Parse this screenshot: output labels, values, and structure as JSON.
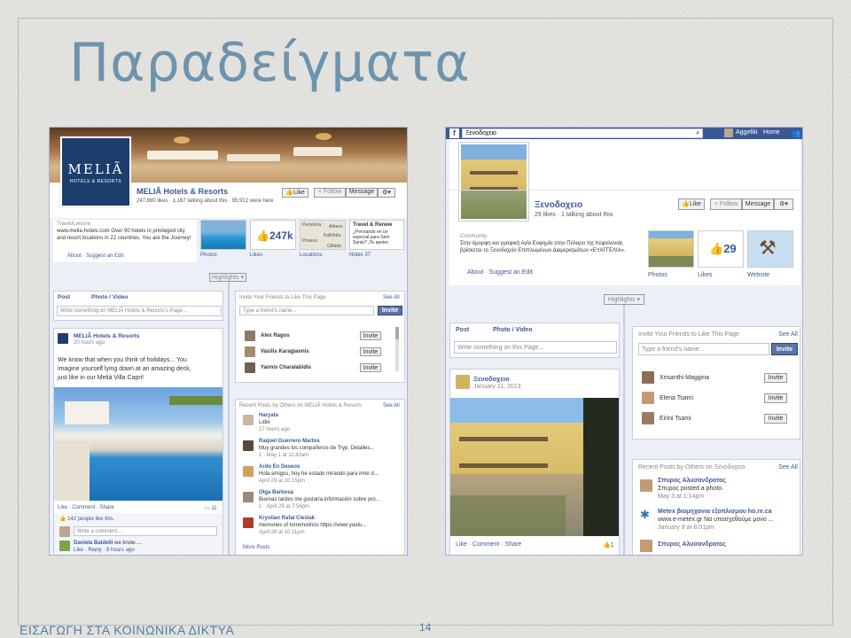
{
  "slide": {
    "title": "Παραδείγματα",
    "footer": "ΕΙΣΑΓΩΓΗ ΣΤΑ ΚΟΙΝΩΝΙΚΑ ΔΙΚΤΥΑ",
    "page_number": "14"
  },
  "left": {
    "logo_text": "MELIÃ",
    "logo_sub": "HOTELS & RESORTS",
    "page_name": "MELIÃ Hotels & Resorts",
    "stats": "247,880 likes · 1,167 talking about this · 95,912 were here",
    "like_btn": "Like",
    "follow_btn": "Follow",
    "message_btn": "Message",
    "category": "Travel/Leisure",
    "about_text": "www.melia-hotels.com Over 90 hotels in privileged city and resort locations in 22 countries. You are the Journey!",
    "about_link": "About",
    "suggest_link": "Suggest an Edit",
    "tabs": [
      "Photos",
      "Likes",
      "Locations",
      "Notes 37"
    ],
    "likes_count": "247k",
    "notes_title": "Travel & Renew",
    "notes_text": "¿Pensando en un especial para Sem Santa? ¡Te apetec",
    "map_labels": [
      "Peristéria",
      "Athens",
      "Kallithéa",
      "Piraeus",
      "Glifáda"
    ],
    "highlights": "Highlights",
    "composer_post": "Post",
    "composer_photo": "Photo / Video",
    "composer_placeholder": "Write something on MELIÃ Hotels & Resorts's Page...",
    "post_author": "MELIÃ Hotels & Resorts",
    "post_time": "20 hours ago",
    "post_text_1": "We know that when you think of holidays... You",
    "post_text_2": "imagine yourself lying down at an amazing deck,",
    "post_text_3": "just like in our Meliá Villa Capri!",
    "post_actions": "Like · Comment · Share",
    "post_shares": "11",
    "post_likes": "142 people like this.",
    "comment_placeholder": "Write a comment...",
    "comment_author": "Daniela Baldelli",
    "comment_text": "we know.....",
    "comment_meta": "Like · Reply · 8 hours ago",
    "invite_title": "Invite Your Friends to Like This Page",
    "see_all": "See All",
    "friend_placeholder": "Type a friend's name...",
    "invite_btn": "Invite",
    "friends": [
      "Alex Ragos",
      "Vasilis Karagiannis",
      "Yannis Charalabidis"
    ],
    "recent_title": "Recent Posts by Others on MELIÃ Hotels & Resorts",
    "recent": [
      {
        "name": "Haryata",
        "text": "Lidie",
        "meta": "17 hours ago"
      },
      {
        "name": "Raquel Guerrero Martos",
        "text": "Muy grandes los compañeros de Tryp. Detalles...",
        "meta": "1 · May 1 at 11:42am"
      },
      {
        "name": "Ardo En Deseos",
        "text": "Hola amigos, hoy he estado mirando para irme d...",
        "meta": "April 29 at 10:15pm"
      },
      {
        "name": "Olga Barbosa",
        "text": "Buenas tardes me gustaría información sobre pro...",
        "meta": "1 · April 29 at 7:56pm"
      },
      {
        "name": "Krystian Rafał Cieślak",
        "text": "memories of torremolinos https://www.youtu...",
        "meta": "April 28 at 10:11pm"
      }
    ],
    "more_posts": "More Posts"
  },
  "right": {
    "search_value": "Ξενοδοχειο",
    "user_name": "Aggeliki",
    "home": "Home",
    "page_name": "Ξενοδοχειο",
    "stats": "29 likes · 1 talking about this",
    "like_btn": "Like",
    "follow_btn": "Follow",
    "message_btn": "Message",
    "category": "Community",
    "about_text": "Στην όμορφη και γραφική Αγία Ευφημία στην Πύλαρο της Κεφαλονιάς βρίσκεται το Ξενοδοχείο Επιπλωμένων Διαμερισμάτων «ΕΥΑΓΓΕΛΙΑ».",
    "about_link": "About",
    "suggest_link": "Suggest an Edit",
    "tabs": [
      "Photos",
      "Likes",
      "Website"
    ],
    "likes_count": "29",
    "highlights": "Highlights",
    "composer_post": "Post",
    "composer_photo": "Photo / Video",
    "composer_placeholder": "Write something on this Page...",
    "post_author": "Ξενοδοχειο",
    "post_time": "January 11, 2013",
    "post_actions": "Like · Comment · Share",
    "post_likes": "1",
    "invite_title": "Invite Your Friends to Like This Page",
    "see_all": "See All",
    "friend_placeholder": "Type a friend's name...",
    "invite_btn": "Invite",
    "friends": [
      "Xrisanthi Maggina",
      "Elena Tsami",
      "Eirini Tsami"
    ],
    "recent_title": "Recent Posts by Others on Ξενοδοχειο",
    "recent": [
      {
        "name": "Σπυρος Αλυσανδρατος",
        "text": "Σπυρος posted a photo.",
        "meta": "May 3 at 1:14pm"
      },
      {
        "name": "Metex βιομηχανια εξοπλισμου ho.re.ca",
        "text": "www.e-metex.gr Να υποσχεθούμε μονο ...",
        "meta": "January 8 at 8:01pm"
      },
      {
        "name": "Σπυρος Αλυσανδρατος",
        "text": "",
        "meta": ""
      }
    ]
  },
  "colors": {
    "title": "#6e93ad",
    "facebook_blue": "#3b5998",
    "background": "#e4e3df"
  }
}
